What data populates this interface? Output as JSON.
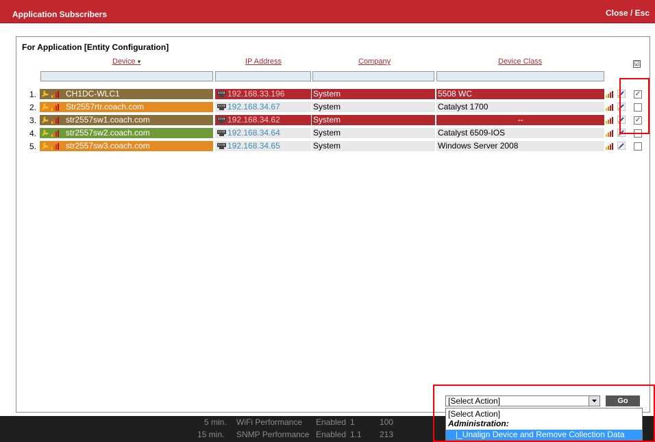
{
  "window": {
    "title": "Application Subscribers",
    "close_label": "Close / Esc"
  },
  "panel": {
    "subtitle": "For Application [Entity Configuration]"
  },
  "columns": {
    "device": "Device",
    "sort_indicator": "▾",
    "ip": "IP Address",
    "company": "Company",
    "device_class": "Device Class",
    "select_all": "☑"
  },
  "rows": [
    {
      "num": "1.",
      "device": "CH1DC-WLC1",
      "ip": "192.168.33.196",
      "company": "System",
      "device_class": "5508 WC",
      "checked": "✓",
      "device_color": "#8a6e3b",
      "row_color": "#b3282e"
    },
    {
      "num": "2.",
      "device": "Str2557rtr.coach.com",
      "ip": "192.168.34.67",
      "company": "System",
      "device_class": "Catalyst 1700",
      "checked": "",
      "device_color": "#e48a25",
      "row_color": "#e8e8e8"
    },
    {
      "num": "3.",
      "device": "str2557sw1.coach.com",
      "ip": "192.168.34.62",
      "company": "System",
      "device_class": "--",
      "checked": "✓",
      "device_color": "#8a6e3b",
      "row_color": "#b3282e"
    },
    {
      "num": "4.",
      "device": "str2557sw2.coach.com",
      "ip": "192.168.34.64",
      "company": "System",
      "device_class": "Catalyst 6509-IOS",
      "checked": "",
      "device_color": "#6e9a3a",
      "row_color": "#e8e8e8"
    },
    {
      "num": "5.",
      "device": "str2557sw3.coach.com",
      "ip": "192.168.34.65",
      "company": "System",
      "device_class": "Windows Server 2008",
      "checked": "",
      "device_color": "#e48a25",
      "row_color": "#e8e8e8"
    }
  ],
  "actions": {
    "select_value": "[Select Action]",
    "go_label": "Go",
    "dropdown": {
      "option_default": "[Select Action]",
      "group_label": "Administration:",
      "option_selected": "|_Unalign Device and Remove Collection Data"
    }
  },
  "background": {
    "row1": [
      "5 min.",
      "WiFi Performance",
      "Enabled",
      "1",
      "100"
    ],
    "row2": [
      "15 min.",
      "SNMP Performance",
      "Enabled",
      "1.1",
      "213"
    ]
  },
  "colors": {
    "accent": "#c1272d",
    "selected_row": "#b3282e",
    "highlight": "#ff0000",
    "link": "#3b8fb5"
  }
}
